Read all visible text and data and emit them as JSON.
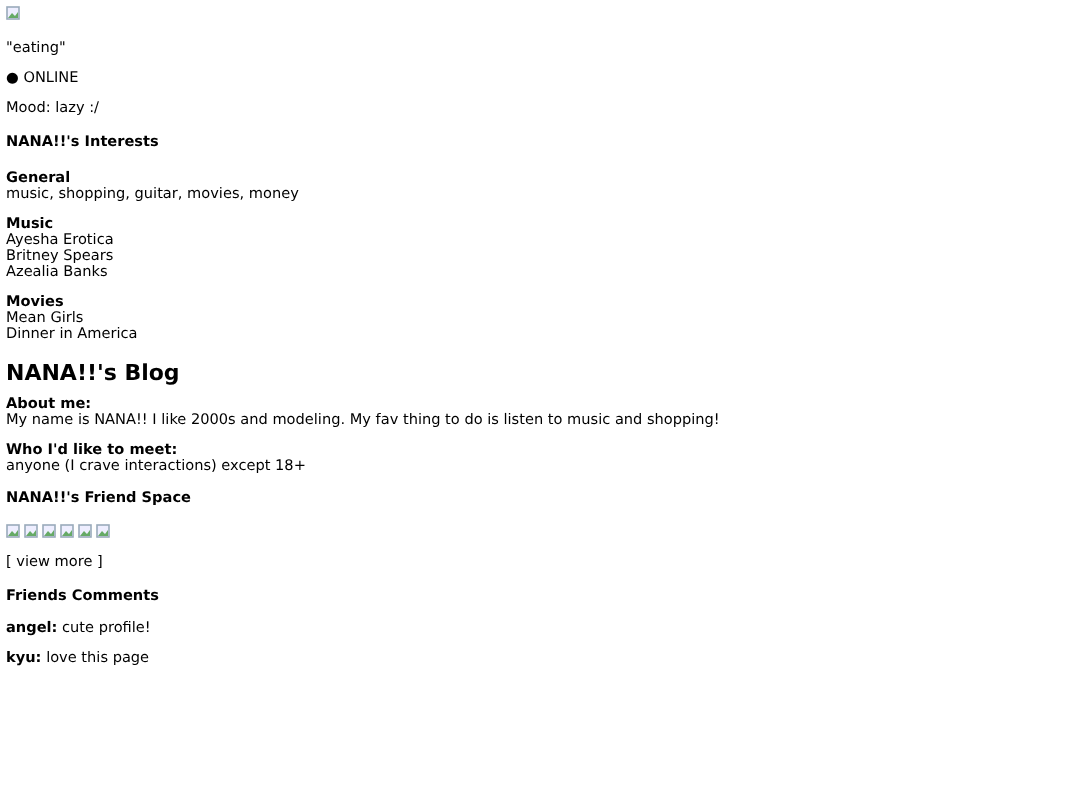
{
  "status": "\"eating\"",
  "online": {
    "dot": "●",
    "label": "ONLINE"
  },
  "mood": "Mood: lazy :/",
  "interests": {
    "title": "NANA!!'s Interests",
    "groups": [
      {
        "heading": "General",
        "lines": [
          "music, shopping, guitar, movies, money"
        ]
      },
      {
        "heading": "Music",
        "lines": [
          "Ayesha Erotica",
          "Britney Spears",
          "Azealia Banks"
        ]
      },
      {
        "heading": "Movies",
        "lines": [
          "Mean Girls",
          "Dinner in America"
        ]
      }
    ]
  },
  "blog": {
    "title": "NANA!!'s Blog",
    "sections": [
      {
        "heading": "About me:",
        "text": "My name is NANA!! I like 2000s and modeling. My fav thing to do is listen to music and shopping!"
      },
      {
        "heading": "Who I'd like to meet:",
        "text": "anyone (I crave interactions) except 18+"
      }
    ]
  },
  "friends": {
    "title": "NANA!!'s Friend Space",
    "images": [
      {
        "kind": "broken"
      },
      {
        "kind": "broken"
      },
      {
        "kind": "broken"
      },
      {
        "kind": "broken"
      },
      {
        "kind": "broken"
      },
      {
        "kind": "broken"
      }
    ],
    "view_more": "[ view more ]"
  },
  "comments": {
    "title": "Friends Comments",
    "items": [
      {
        "author": "angel:",
        "text": "cute profile!"
      },
      {
        "author": "kyu:",
        "text": "love this page"
      }
    ]
  }
}
